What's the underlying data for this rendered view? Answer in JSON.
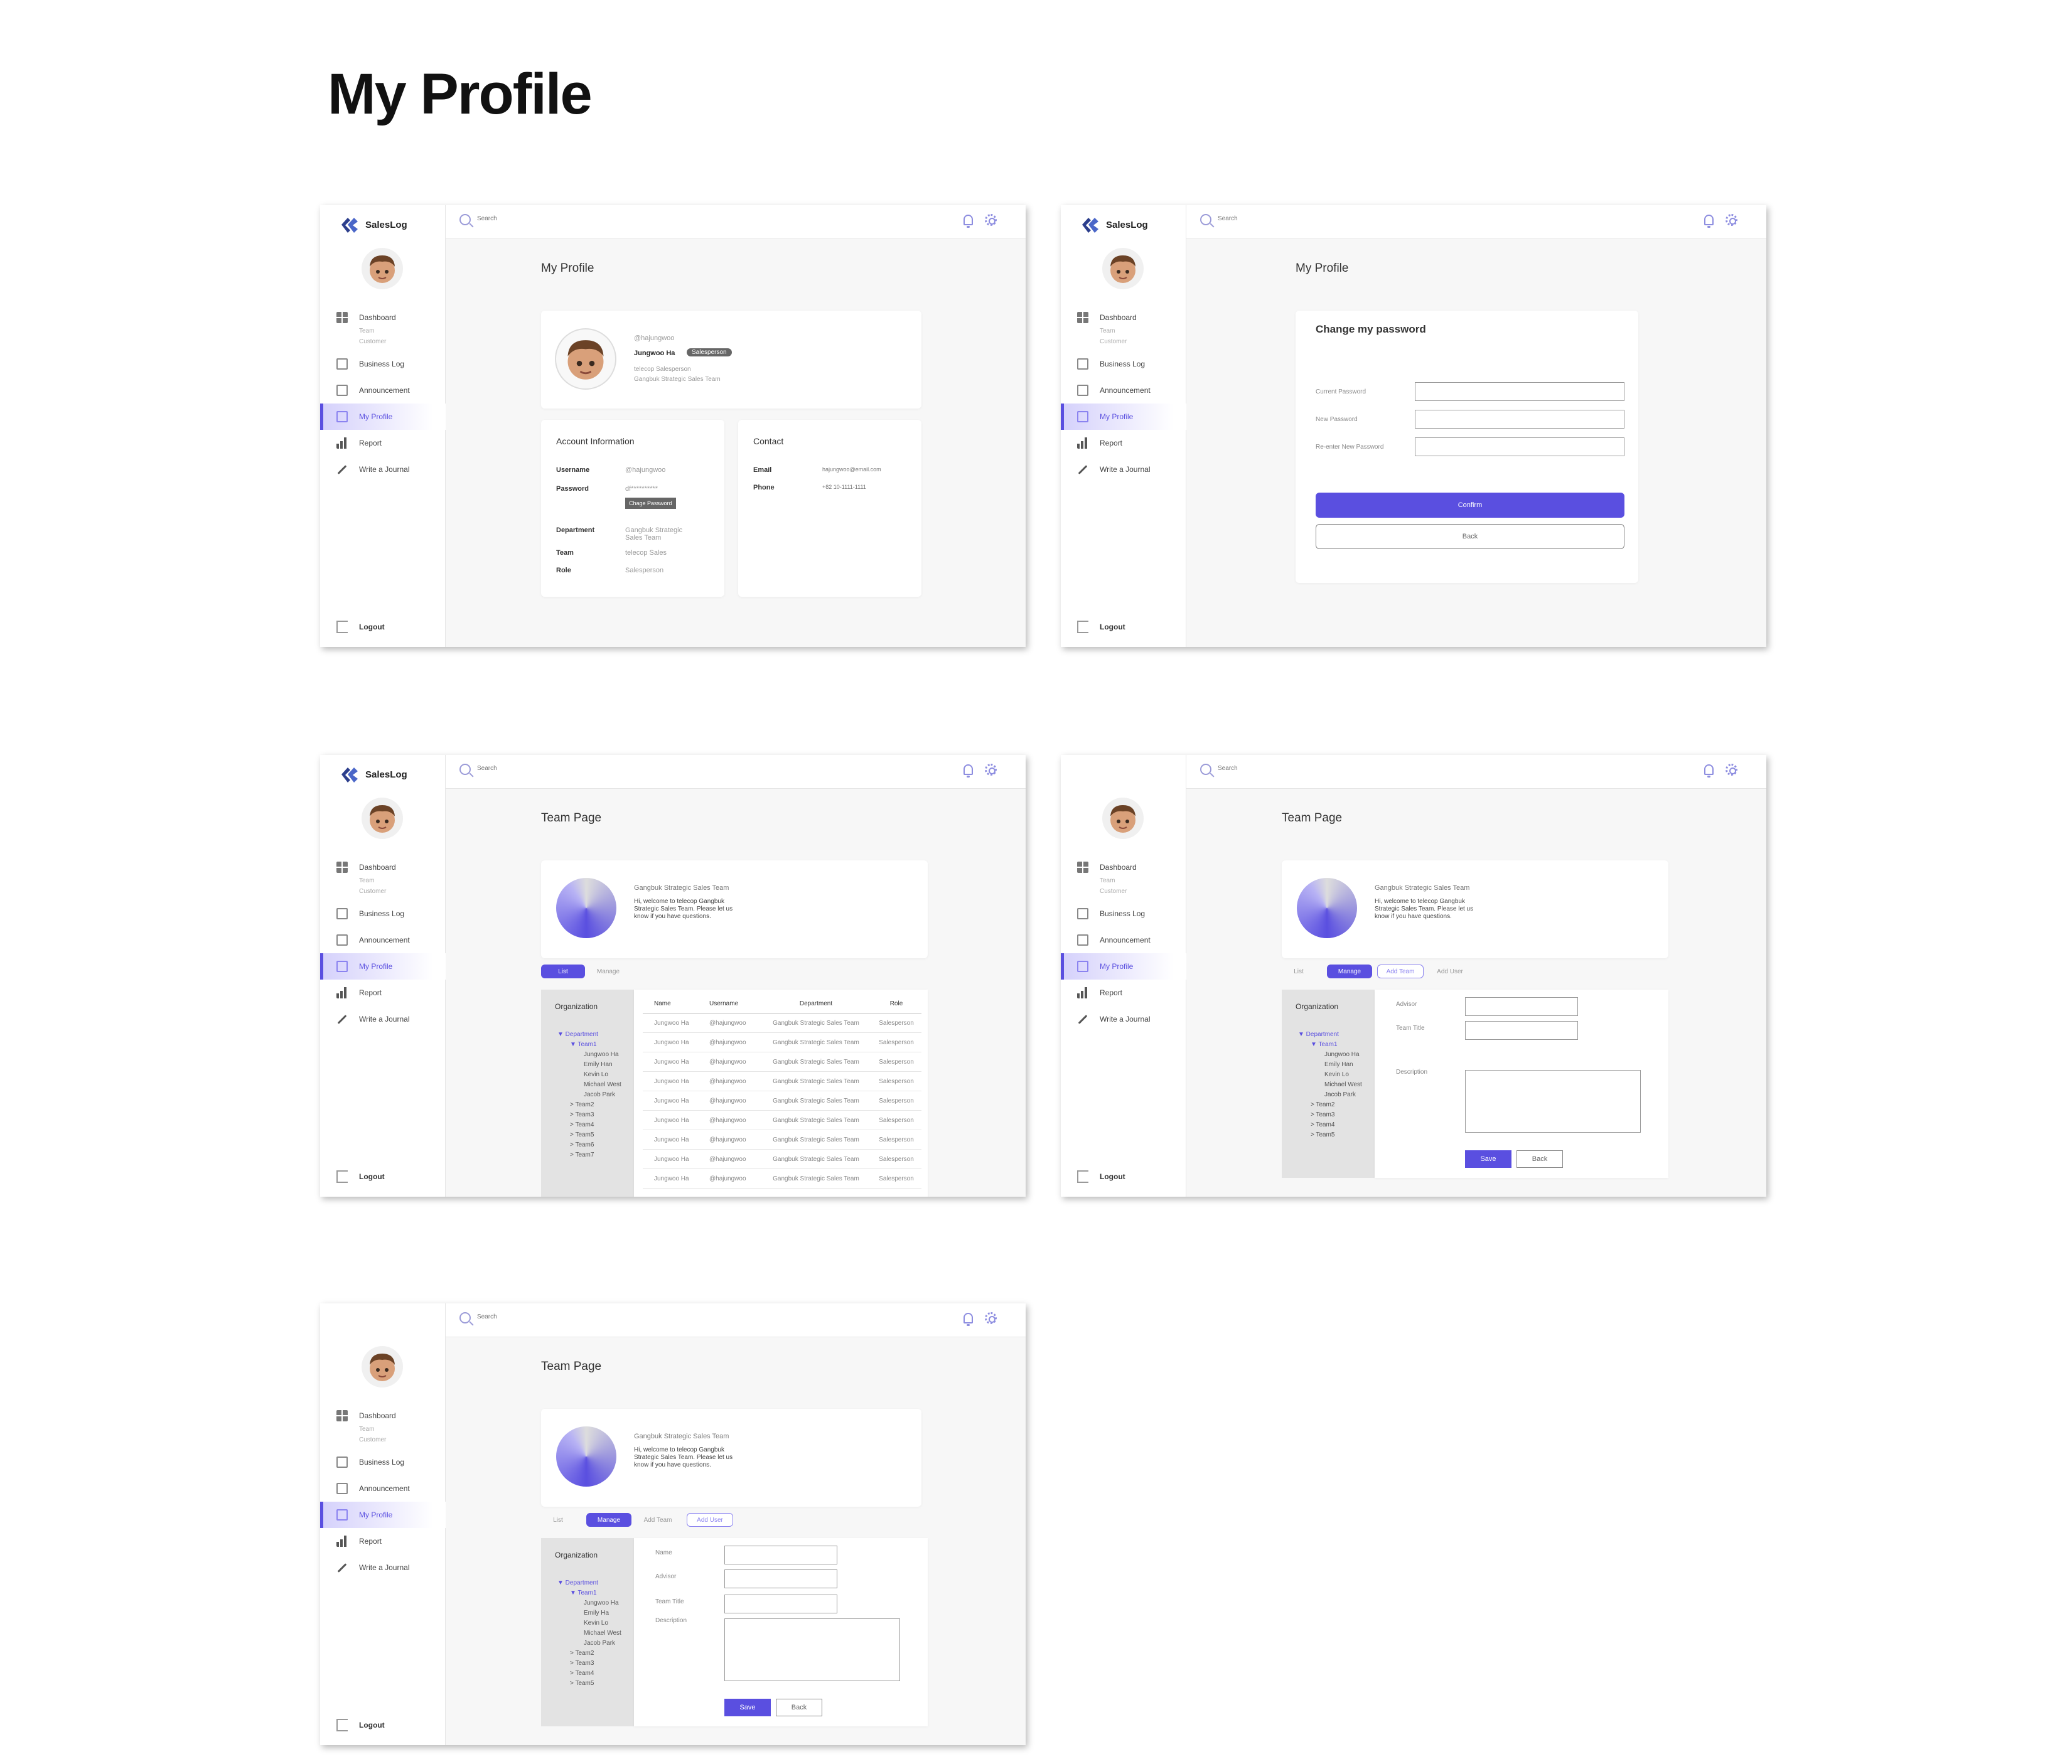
{
  "page_title": "My Profile",
  "app": {
    "name": "SalesLog",
    "search_placeholder": "Search",
    "nav": {
      "dashboard": "Dashboard",
      "dashboard_sub": [
        "Team",
        "Customer"
      ],
      "business_log": "Business Log",
      "announcement": "Announcement",
      "my_profile": "My Profile",
      "report": "Report",
      "write_journal": "Write a Journal",
      "logout": "Logout"
    }
  },
  "screen1": {
    "title": "My Profile",
    "handle": "@hajungwoo",
    "name": "Jungwoo Ha",
    "role_badge": "Salesperson",
    "position": "telecop Salesperson",
    "team_line": "Gangbuk Strategic Sales Team",
    "account": {
      "heading": "Account Information",
      "username_label": "Username",
      "username": "@hajungwoo",
      "password_label": "Password",
      "password": "df**********",
      "change_password": "Chage Password",
      "department_label": "Department",
      "department": "Gangbuk Strategic Sales Team",
      "team_label": "Team",
      "team": "telecop Sales",
      "role_label": "Role",
      "role": "Salesperson"
    },
    "contact": {
      "heading": "Contact",
      "email_label": "Email",
      "email": "hajungwoo@email.com",
      "phone_label": "Phone",
      "phone": "+82 10-1111-1111"
    }
  },
  "screen2": {
    "title": "My Profile",
    "card_title": "Change my password",
    "current_label": "Current Password",
    "new_label": "New Password",
    "reenter_label": "Re-enter New Password",
    "confirm": "Confirm",
    "back": "Back"
  },
  "team": {
    "title": "Team Page",
    "name": "Gangbuk Strategic Sales Team",
    "welcome": "Hi, welcome to telecop Gangbuk Strategic Sales Team. Please let us know if you have questions.",
    "tabs": {
      "list": "List",
      "manage": "Manage",
      "add_team": "Add Team",
      "add_user": "Add User"
    },
    "org_heading": "Organization",
    "tree": {
      "department": "▼ Department",
      "team1": "▼ Team1",
      "members": [
        "Jungwoo Ha",
        "Emily Han",
        "Kevin Lo",
        "Michael West",
        "Jacob Park"
      ],
      "teams7": [
        "> Team2",
        "> Team3",
        "> Team4",
        "> Team5",
        "> Team6",
        "> Team7"
      ],
      "teams5": [
        "> Team2",
        "> Team3",
        "> Team4",
        "> Team5"
      ]
    },
    "members_alt": [
      "Jungwoo Ha",
      "Emily Ha",
      "Kevin Lo",
      "Michael West",
      "Jacob Park"
    ],
    "table": {
      "headers": [
        "Name",
        "Username",
        "Department",
        "Role"
      ],
      "rows": [
        [
          "Jungwoo Ha",
          "@hajungwoo",
          "Gangbuk Strategic Sales Team",
          "Salesperson"
        ],
        [
          "Jungwoo Ha",
          "@hajungwoo",
          "Gangbuk Strategic Sales Team",
          "Salesperson"
        ],
        [
          "Jungwoo Ha",
          "@hajungwoo",
          "Gangbuk Strategic Sales Team",
          "Salesperson"
        ],
        [
          "Jungwoo Ha",
          "@hajungwoo",
          "Gangbuk Strategic Sales Team",
          "Salesperson"
        ],
        [
          "Jungwoo Ha",
          "@hajungwoo",
          "Gangbuk Strategic Sales Team",
          "Salesperson"
        ],
        [
          "Jungwoo Ha",
          "@hajungwoo",
          "Gangbuk Strategic Sales Team",
          "Salesperson"
        ],
        [
          "Jungwoo Ha",
          "@hajungwoo",
          "Gangbuk Strategic Sales Team",
          "Salesperson"
        ],
        [
          "Jungwoo Ha",
          "@hajungwoo",
          "Gangbuk Strategic Sales Team",
          "Salesperson"
        ],
        [
          "Jungwoo Ha",
          "@hajungwoo",
          "Gangbuk Strategic Sales Team",
          "Salesperson"
        ]
      ]
    },
    "form": {
      "name": "Name",
      "advisor": "Advisor",
      "team_title": "Team Title",
      "description": "Description",
      "save": "Save",
      "back": "Back"
    }
  },
  "colors": {
    "accent": "#5a4fe0",
    "accent_light": "#8b83f0"
  }
}
